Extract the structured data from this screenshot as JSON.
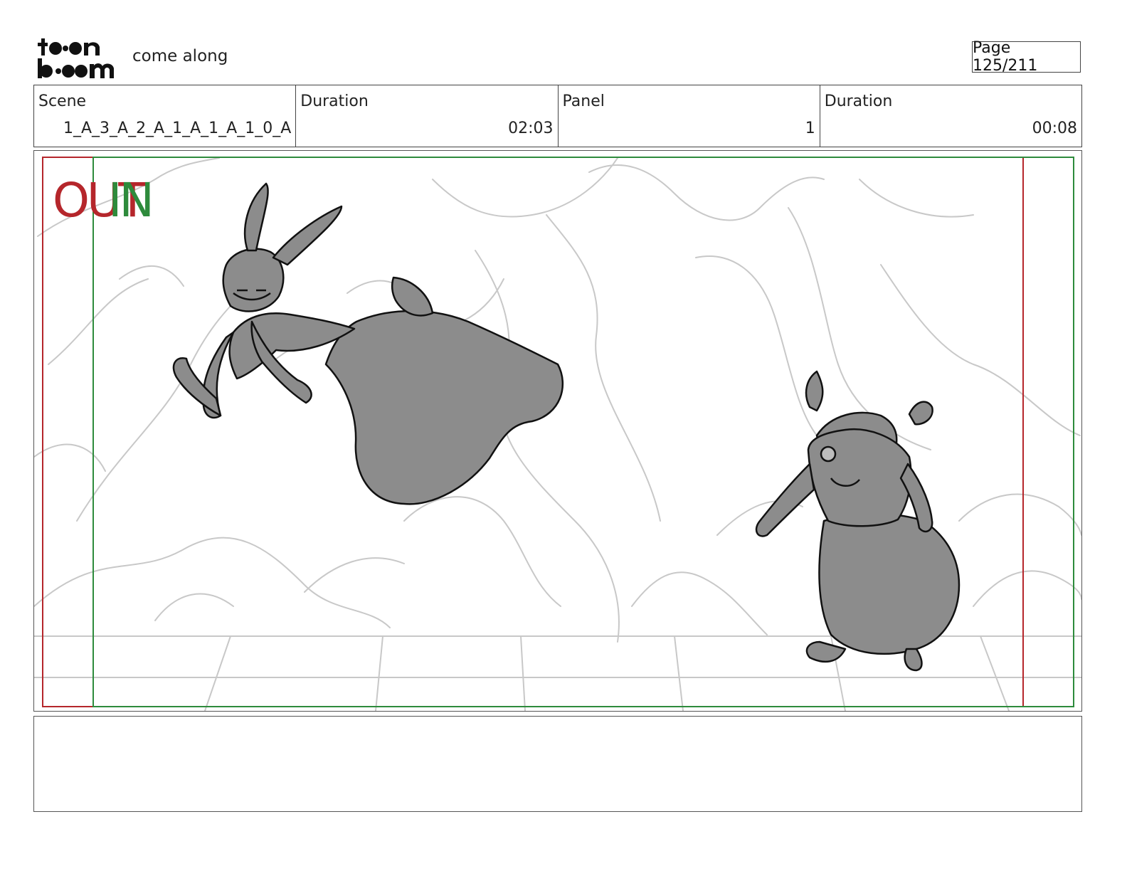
{
  "header": {
    "logo_text": "toon boom",
    "project_title": "come along",
    "page_label": "Page 125/211"
  },
  "info": {
    "scene_label": "Scene",
    "scene_value": "1_A_3_A_2_A_1_A_1_A_1_0_A",
    "scene_duration_label": "Duration",
    "scene_duration_value": "02:03",
    "panel_label": "Panel",
    "panel_value": "1",
    "panel_duration_label": "Duration",
    "panel_duration_value": "00:08"
  },
  "panel": {
    "out_mark": "OUT",
    "in_mark": "IN",
    "colors": {
      "out_frame": "#b5262b",
      "in_frame": "#2e8b3c",
      "sketch_gray": "#c8c8c8",
      "character_fill": "#8c8c8c"
    }
  },
  "caption": {
    "text": ""
  }
}
